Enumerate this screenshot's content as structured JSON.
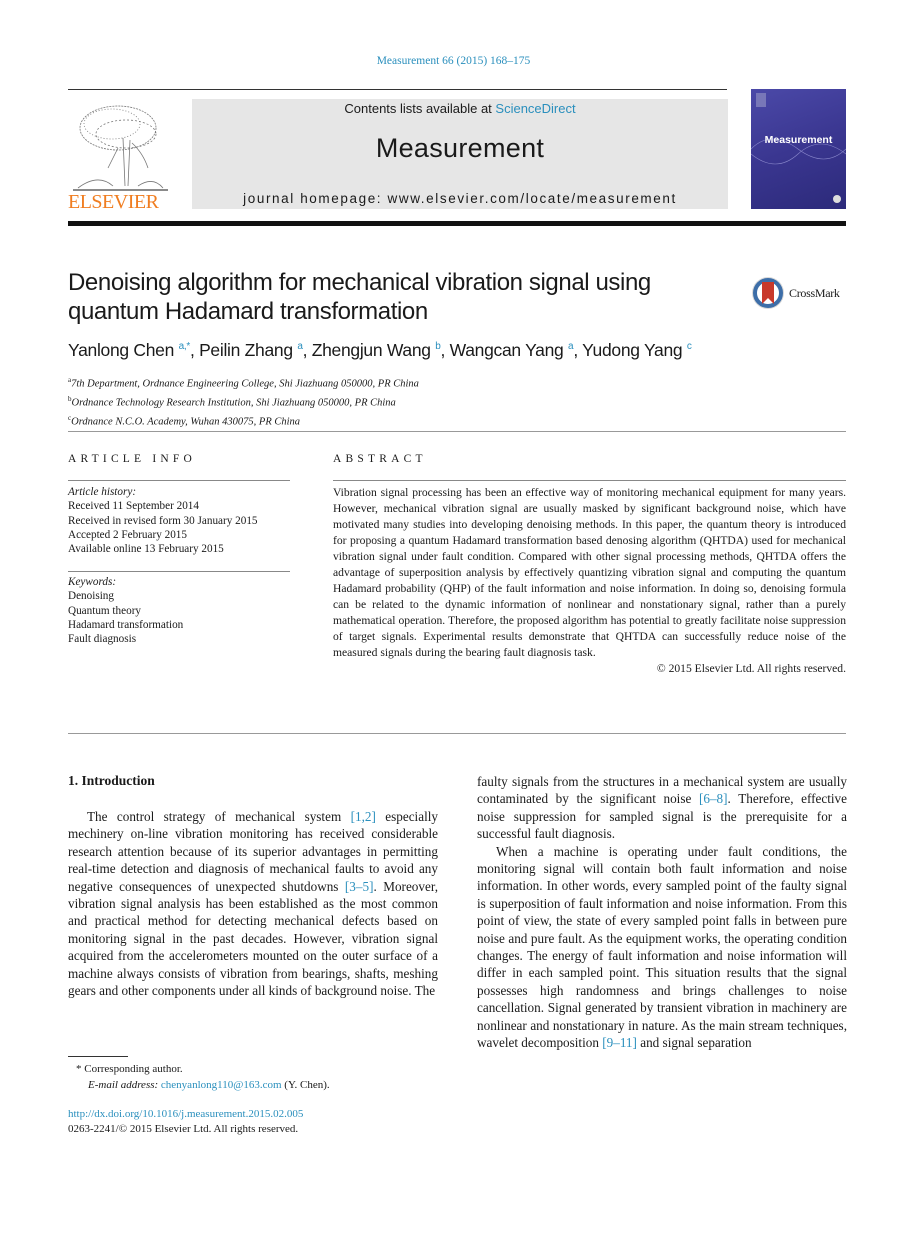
{
  "header": {
    "citation": "Measurement 66 (2015) 168–175",
    "contents_prefix": "Contents lists available at ",
    "contents_link": "ScienceDirect",
    "journal_name": "Measurement",
    "homepage": "journal homepage: www.elsevier.com/locate/measurement",
    "publisher_logo": "ELSEVIER",
    "cover_title": "Measurement",
    "colors": {
      "link": "#2a8fbd",
      "elsevier_orange": "#f07d20",
      "cover_blue": "#3a3690"
    }
  },
  "article": {
    "title": "Denoising algorithm for mechanical vibration signal using quantum Hadamard transformation",
    "crossmark_label": "CrossMark",
    "authors": [
      {
        "name": "Yanlong Chen",
        "sup": "a,*"
      },
      {
        "name": "Peilin Zhang",
        "sup": "a"
      },
      {
        "name": "Zhengjun Wang",
        "sup": "b"
      },
      {
        "name": "Wangcan Yang",
        "sup": "a"
      },
      {
        "name": "Yudong Yang",
        "sup": "c"
      }
    ],
    "affiliations": [
      {
        "sup": "a",
        "text": "7th Department, Ordnance Engineering College, Shi Jiazhuang 050000, PR China"
      },
      {
        "sup": "b",
        "text": "Ordnance Technology Research Institution, Shi Jiazhuang 050000, PR China"
      },
      {
        "sup": "c",
        "text": "Ordnance N.C.O. Academy, Wuhan 430075, PR China"
      }
    ]
  },
  "article_info": {
    "heading": "ARTICLE INFO",
    "history_label": "Article history:",
    "history": [
      "Received 11 September 2014",
      "Received in revised form 30 January 2015",
      "Accepted 2 February 2015",
      "Available online 13 February 2015"
    ],
    "keywords_label": "Keywords:",
    "keywords": [
      "Denoising",
      "Quantum theory",
      "Hadamard transformation",
      "Fault diagnosis"
    ]
  },
  "abstract": {
    "heading": "ABSTRACT",
    "text": "Vibration signal processing has been an effective way of monitoring mechanical equipment for many years. However, mechanical vibration signal are usually masked by significant background noise, which have motivated many studies into developing denoising methods. In this paper, the quantum theory is introduced for proposing a quantum Hadamard transformation based denosing algorithm (QHTDA) used for mechanical vibration signal under fault condition. Compared with other signal processing methods, QHTDA offers the advantage of superposition analysis by effectively quantizing vibration signal and computing the quantum Hadamard probability (QHP) of the fault information and noise information. In doing so, denoising formula can be related to the dynamic information of nonlinear and nonstationary signal, rather than a purely mathematical operation. Therefore, the proposed algorithm has potential to greatly facilitate noise suppression of target signals. Experimental results demonstrate that QHTDA can successfully reduce noise of the measured signals during the bearing fault diagnosis task.",
    "copyright": "© 2015 Elsevier Ltd. All rights reserved."
  },
  "body": {
    "section_title": "1. Introduction",
    "col1": {
      "p1_a": "The control strategy of mechanical system ",
      "ref1": "[1,2]",
      "p1_b": " especially mechinery on-line vibration monitoring has received considerable research attention because of its superior advantages in permitting real-time detection and diagnosis of mechanical faults to avoid any negative consequences of unexpected shutdowns ",
      "ref2": "[3–5]",
      "p1_c": ". Moreover, vibration signal analysis has been established as the most common and practical method for detecting mechanical defects based on monitoring signal in the past decades. However, vibration signal acquired from the accelerometers mounted on the outer surface of a machine always consists of vibration from bearings, shafts, meshing gears and other components under all kinds of background noise. The"
    },
    "col2": {
      "p1_a": "faulty signals from the structures in a mechanical system are usually contaminated by the significant noise ",
      "ref1": "[6–8]",
      "p1_b": ". Therefore, effective noise suppression for sampled signal is the prerequisite for a successful fault diagnosis.",
      "p2_a": "When a machine is operating under fault conditions, the monitoring signal will contain both fault information and noise information. In other words, every sampled point of the faulty signal is superposition of fault information and noise information. From this point of view, the state of every sampled point falls in between pure noise and pure fault. As the equipment works, the operating condition changes. The energy of fault information and noise information will differ in each sampled point. This situation results that the signal possesses high randomness and brings challenges to noise cancellation. Signal generated by transient vibration in machinery are nonlinear and nonstationary in nature. As the main stream techniques, wavelet decomposition ",
      "ref2": "[9–11]",
      "p2_b": " and signal separation"
    }
  },
  "footnotes": {
    "corresponding_mark": "*",
    "corresponding": "Corresponding author.",
    "email_label": "E-mail address: ",
    "email": "chenyanlong110@163.com",
    "email_suffix": " (Y. Chen).",
    "doi": "http://dx.doi.org/10.1016/j.measurement.2015.02.005",
    "issn": "0263-2241/© 2015 Elsevier Ltd. All rights reserved."
  }
}
